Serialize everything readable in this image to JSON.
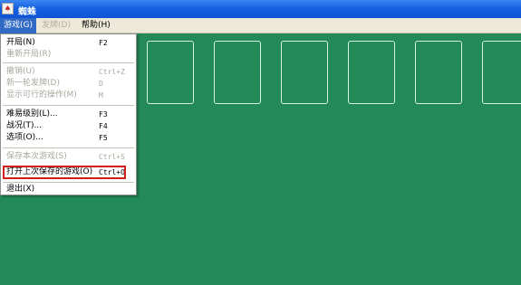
{
  "window": {
    "title": "蜘蛛",
    "icon": "spider-app-icon"
  },
  "menubar": [
    {
      "label": "游戏(G)",
      "state": "active"
    },
    {
      "label": "发牌(D)",
      "state": "disabled"
    },
    {
      "label": "帮助(H)",
      "state": "normal"
    }
  ],
  "game_menu": {
    "items": [
      {
        "label": "开局(N)",
        "shortcut": "F2",
        "disabled": false
      },
      {
        "label": "重新开局(R)",
        "shortcut": "",
        "disabled": true
      },
      {
        "label": "撤销(U)",
        "shortcut": "Ctrl+Z",
        "disabled": true
      },
      {
        "label": "新一轮发牌(D)",
        "shortcut": "D",
        "disabled": true
      },
      {
        "label": "显示可行的操作(M)",
        "shortcut": "M",
        "disabled": true
      },
      {
        "label": "难易级别(L)...",
        "shortcut": "F3",
        "disabled": false
      },
      {
        "label": "战况(T)...",
        "shortcut": "F4",
        "disabled": false
      },
      {
        "label": "选项(O)...",
        "shortcut": "F5",
        "disabled": false
      },
      {
        "label": "保存本次游戏(S)",
        "shortcut": "Ctrl+S",
        "disabled": true
      },
      {
        "label": "打开上次保存的游戏(O)",
        "shortcut": "Ctrl+O",
        "disabled": false
      },
      {
        "label": "退出(X)",
        "shortcut": "",
        "disabled": false
      }
    ]
  },
  "colors": {
    "table_green": "#238a57",
    "titlebar_blue": "#1661e0",
    "menu_highlight": "#316ac5",
    "annotation_red": "#d21c1c"
  }
}
